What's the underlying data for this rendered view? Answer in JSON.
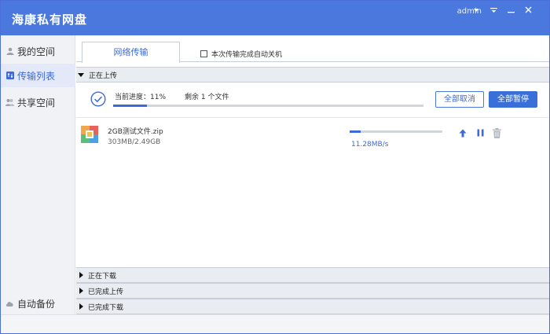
{
  "app": {
    "title": "海康私有网盘",
    "user": "admin",
    "menu_icon": "menu-icon",
    "minimize_icon": "minimize-icon",
    "close_icon": "close-icon"
  },
  "sidebar": {
    "items": [
      {
        "label": "我的空间",
        "icon": "user-icon",
        "active": false
      },
      {
        "label": "传输列表",
        "icon": "transfer-icon",
        "active": true
      },
      {
        "label": "共享空间",
        "icon": "share-icon",
        "active": false
      }
    ],
    "backup": {
      "label": "自动备份",
      "icon": "cloud-icon"
    }
  },
  "tabs": {
    "active_label": "网络传输",
    "shutdown_label": "本次传输完成自动关机",
    "shutdown_checked": false
  },
  "uploading": {
    "header": "正在上传",
    "progress_label": "当前进度：11%",
    "progress_value": 11,
    "remaining_label": "剩余 1 个文件",
    "cancel_all_label": "全部取消",
    "pause_all_label": "全部暂停",
    "files": [
      {
        "name": "2GB测试文件.zip",
        "size": "303MB/2.49GB",
        "speed": "11.28MB/s",
        "progress": 12,
        "actions": [
          "upload-icon",
          "pause-icon",
          "delete-icon"
        ]
      }
    ]
  },
  "sections": {
    "downloading": "正在下载",
    "uploaded": "已完成上传",
    "downloaded": "已完成下载"
  },
  "colors": {
    "accent": "#3d6ad6",
    "titlebar": "#4a78dd",
    "sidebar_bg": "#f0f2f5",
    "section_bg": "#e9ecf1"
  }
}
